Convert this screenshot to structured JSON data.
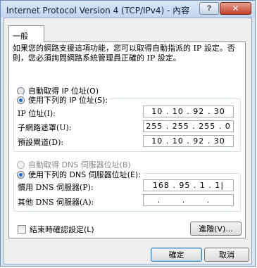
{
  "window": {
    "title": "Internet Protocol Version 4 (TCP/IPv4) - 內容"
  },
  "titlebar": {
    "help_label": "?",
    "close_label": "✕"
  },
  "tabs": [
    {
      "label": "一般"
    }
  ],
  "description": "如果您的網路支援這項功能，您可以取得自動指派的 IP 設定。否則，您必須詢問網路系統管理員正確的 IP 設定。",
  "ip": {
    "auto_label": "自動取得 IP 位址(O)",
    "manual_label": "使用下列的 IP 位址(S):",
    "fields": {
      "address": {
        "label": "IP 位址(I):",
        "value": "10 . 10 . 92 . 30"
      },
      "subnet": {
        "label": "子網路遮罩(U):",
        "value": "255 . 255 . 255 . 0"
      },
      "gateway": {
        "label": "預設閘道(D):",
        "value": "10 . 10 . 92 . 30"
      }
    }
  },
  "dns": {
    "auto_label": "自動取得 DNS 伺服器位址(B)",
    "manual_label": "使用下列的 DNS 伺服器位址(E):",
    "fields": {
      "preferred": {
        "label": "慣用 DNS 伺服器(P):",
        "value": "168 . 95 . 1 . 1|"
      },
      "alternate": {
        "label": "其他 DNS 伺服器(A):",
        "value": ". . ."
      }
    }
  },
  "validate": {
    "label": "結束時確認設定(L)"
  },
  "buttons": {
    "advanced": "進階(V)...",
    "ok": "確定",
    "cancel": "取消"
  }
}
